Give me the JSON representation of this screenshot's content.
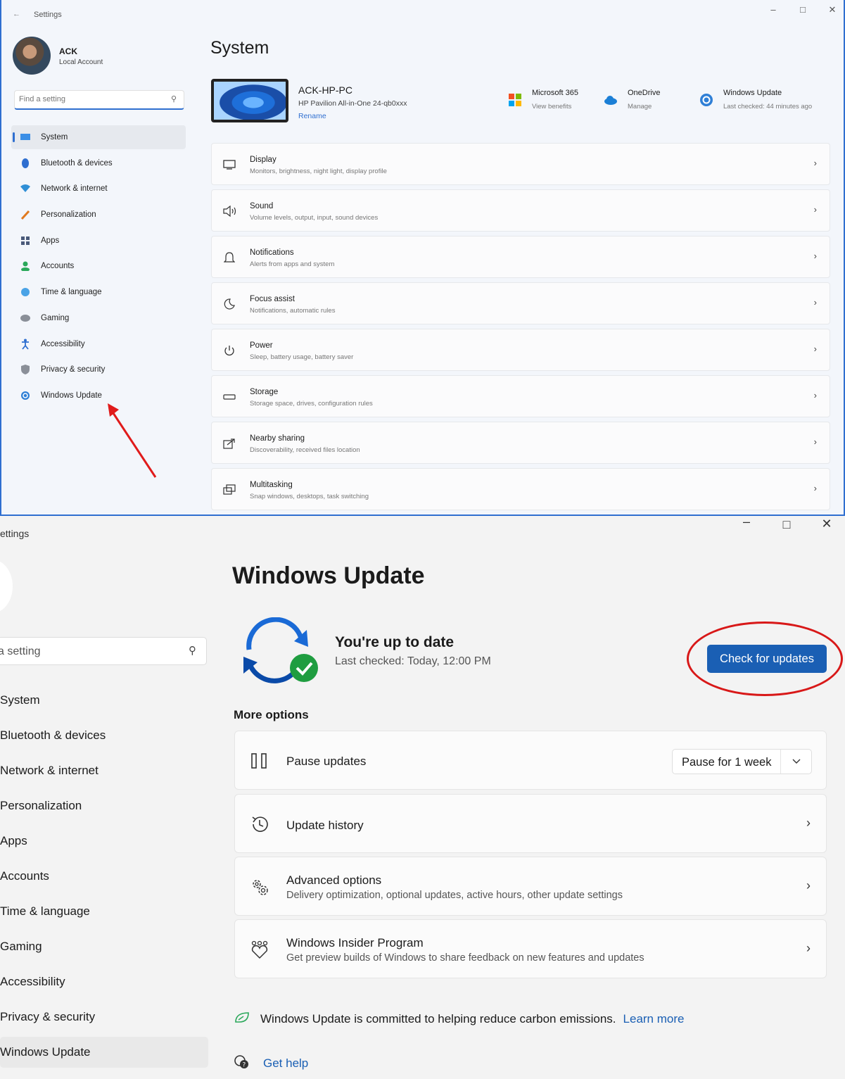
{
  "window_system": {
    "app_title": "Settings",
    "account": {
      "name": "ACK",
      "type": "Local Account"
    },
    "search_placeholder": "Find a setting",
    "nav": [
      {
        "label": "System",
        "icon": "system-icon",
        "active": true
      },
      {
        "label": "Bluetooth & devices",
        "icon": "bluetooth-icon"
      },
      {
        "label": "Network & internet",
        "icon": "network-icon"
      },
      {
        "label": "Personalization",
        "icon": "brush-icon"
      },
      {
        "label": "Apps",
        "icon": "apps-icon"
      },
      {
        "label": "Accounts",
        "icon": "accounts-icon"
      },
      {
        "label": "Time & language",
        "icon": "globe-clock-icon"
      },
      {
        "label": "Gaming",
        "icon": "gamepad-icon"
      },
      {
        "label": "Accessibility",
        "icon": "accessibility-icon"
      },
      {
        "label": "Privacy & security",
        "icon": "shield-icon"
      },
      {
        "label": "Windows Update",
        "icon": "update-icon"
      }
    ],
    "page_title": "System",
    "device": {
      "name": "ACK-HP-PC",
      "model": "HP Pavilion All-in-One 24-qb0xxx",
      "rename": "Rename"
    },
    "services": [
      {
        "title": "Microsoft 365",
        "sub": "View benefits",
        "icon": "microsoft-icon"
      },
      {
        "title": "OneDrive",
        "sub": "Manage",
        "icon": "onedrive-icon"
      },
      {
        "title": "Windows Update",
        "sub": "Last checked: 44 minutes ago",
        "icon": "windows-update-icon"
      }
    ],
    "cards": [
      {
        "title": "Display",
        "sub": "Monitors, brightness, night light, display profile",
        "icon": "display-icon"
      },
      {
        "title": "Sound",
        "sub": "Volume levels, output, input, sound devices",
        "icon": "speaker-icon"
      },
      {
        "title": "Notifications",
        "sub": "Alerts from apps and system",
        "icon": "bell-icon"
      },
      {
        "title": "Focus assist",
        "sub": "Notifications, automatic rules",
        "icon": "moon-icon"
      },
      {
        "title": "Power",
        "sub": "Sleep, battery usage, battery saver",
        "icon": "power-icon"
      },
      {
        "title": "Storage",
        "sub": "Storage space, drives, configuration rules",
        "icon": "storage-icon"
      },
      {
        "title": "Nearby sharing",
        "sub": "Discoverability, received files location",
        "icon": "share-icon"
      },
      {
        "title": "Multitasking",
        "sub": "Snap windows, desktops, task switching",
        "icon": "multitask-icon"
      }
    ]
  },
  "window_update": {
    "app_title": "ettings",
    "search_placeholder": "a setting",
    "nav": [
      {
        "label": "System"
      },
      {
        "label": "Bluetooth & devices"
      },
      {
        "label": "Network & internet"
      },
      {
        "label": "Personalization"
      },
      {
        "label": "Apps"
      },
      {
        "label": "Accounts"
      },
      {
        "label": "Time & language"
      },
      {
        "label": "Gaming"
      },
      {
        "label": "Accessibility"
      },
      {
        "label": "Privacy & security"
      },
      {
        "label": "Windows Update",
        "active": true
      }
    ],
    "page_title": "Windows Update",
    "status": {
      "title": "You're up to date",
      "sub": "Last checked: Today, 12:00 PM"
    },
    "check_button": "Check for updates",
    "more_options": "More options",
    "pause": {
      "label": "Pause updates",
      "value": "Pause for 1 week"
    },
    "history": {
      "label": "Update history"
    },
    "advanced": {
      "label": "Advanced options",
      "sub": "Delivery optimization, optional updates, active hours, other update settings"
    },
    "insider": {
      "label": "Windows Insider Program",
      "sub": "Get preview builds of Windows to share feedback on new features and updates"
    },
    "carbon": {
      "text": "Windows Update is committed to helping reduce carbon emissions.",
      "link": "Learn more"
    },
    "help": "Get help"
  },
  "colors": {
    "accent": "#1a5fb4",
    "annotation_red": "#d81818"
  }
}
